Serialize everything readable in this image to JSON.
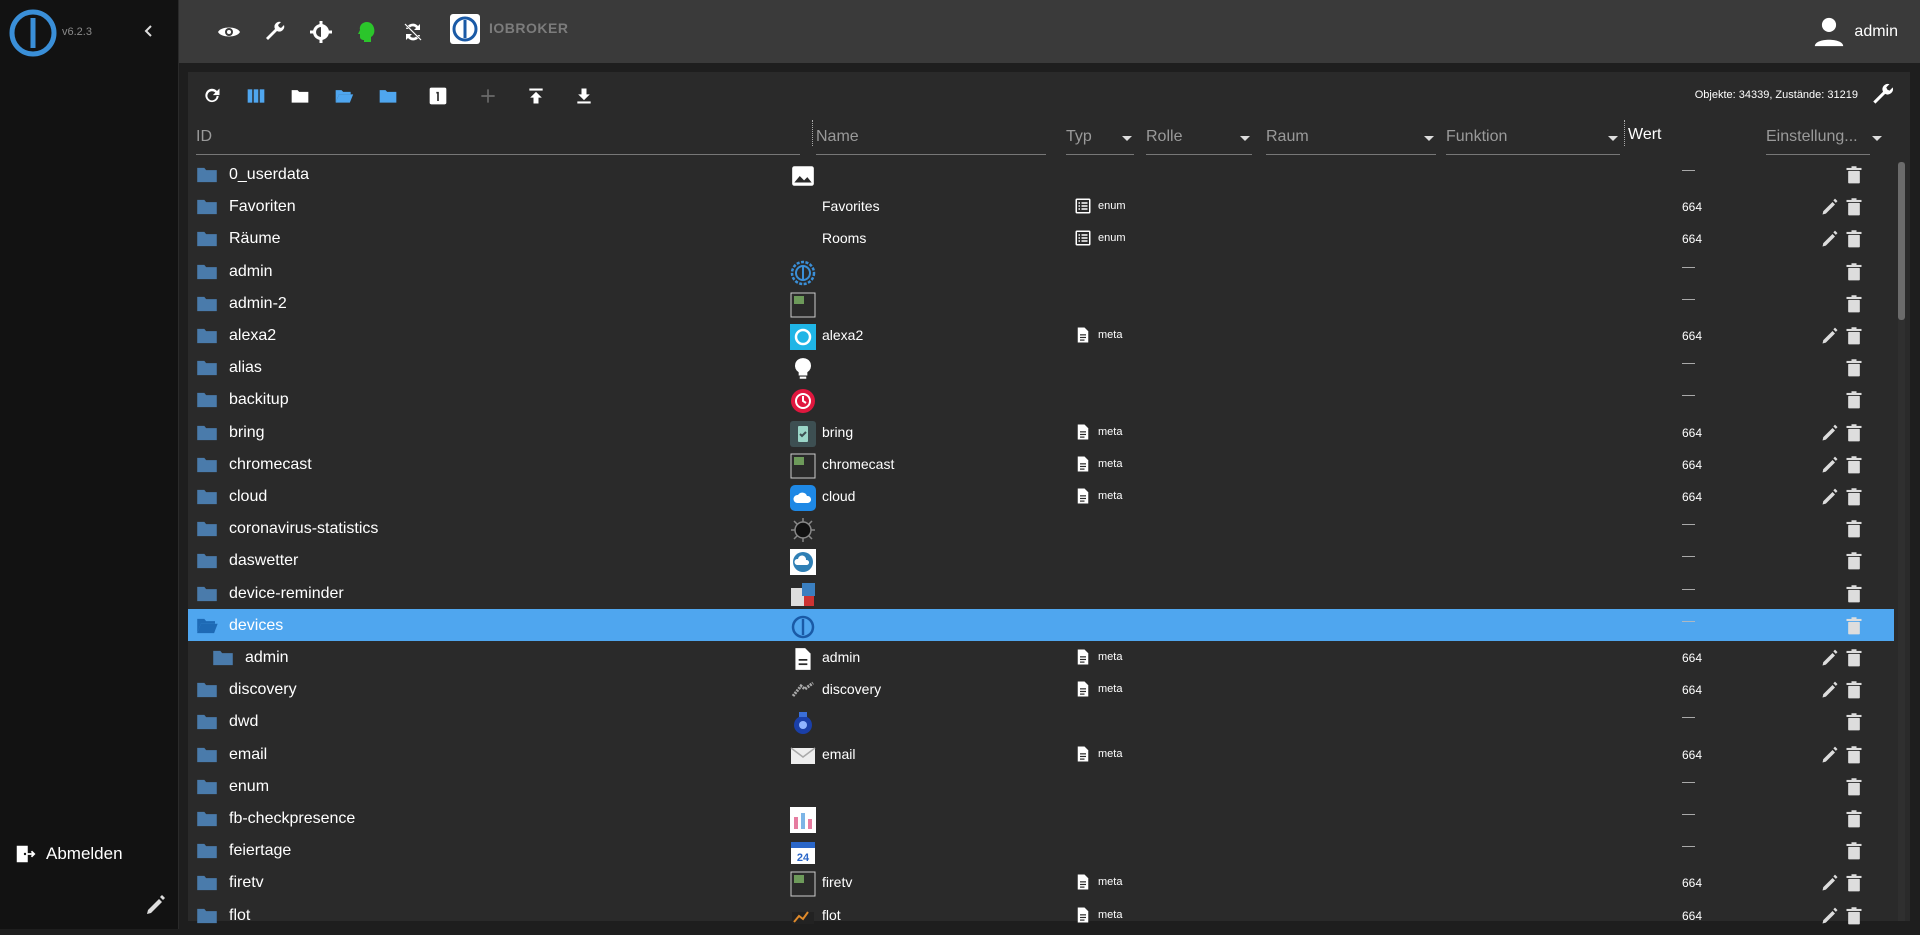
{
  "app": {
    "version": "v6.2.3",
    "brand_label": "IOBROKER",
    "user_name": "admin",
    "logout_label": "Abmelden"
  },
  "topbar_icons": [
    "eye-icon",
    "wrench-icon",
    "gear-icon",
    "head-icon",
    "sync-icon"
  ],
  "toolbar": {
    "stats": "Objekte: 34339, Zustände: 31219"
  },
  "columns": {
    "id": "ID",
    "name": "Name",
    "type": "Typ",
    "role": "Rolle",
    "room": "Raum",
    "function": "Funktion",
    "value": "Wert",
    "settings": "Einstellung..."
  },
  "rows": [
    {
      "id": "0_userdata",
      "icon": "image-icon",
      "name": "",
      "type": "",
      "rights": "—"
    },
    {
      "id": "Favoriten",
      "icon": "",
      "name": "Favorites",
      "type": "enum",
      "rights": "664"
    },
    {
      "id": "Räume",
      "icon": "",
      "name": "Rooms",
      "type": "enum",
      "rights": "664"
    },
    {
      "id": "admin",
      "icon": "iobroker-gear-icon",
      "name": "",
      "type": "",
      "rights": "—"
    },
    {
      "id": "admin-2",
      "icon": "broken-image-icon",
      "name": "",
      "type": "",
      "rights": "—"
    },
    {
      "id": "alexa2",
      "icon": "alexa-icon",
      "name": "alexa2",
      "type": "meta",
      "rights": "664"
    },
    {
      "id": "alias",
      "icon": "lightbulb-icon",
      "name": "",
      "type": "",
      "rights": "—"
    },
    {
      "id": "backitup",
      "icon": "backup-icon",
      "name": "",
      "type": "",
      "rights": "—"
    },
    {
      "id": "bring",
      "icon": "bring-icon",
      "name": "bring",
      "type": "meta",
      "rights": "664"
    },
    {
      "id": "chromecast",
      "icon": "broken-image-icon",
      "name": "chromecast",
      "type": "meta",
      "rights": "664"
    },
    {
      "id": "cloud",
      "icon": "cloud-icon",
      "name": "cloud",
      "type": "meta",
      "rights": "664"
    },
    {
      "id": "coronavirus-statistics",
      "icon": "virus-icon",
      "name": "",
      "type": "",
      "rights": "—"
    },
    {
      "id": "daswetter",
      "icon": "weather-icon",
      "name": "",
      "type": "",
      "rights": "—"
    },
    {
      "id": "device-reminder",
      "icon": "reminder-icon",
      "name": "",
      "type": "",
      "rights": "—"
    },
    {
      "id": "devices",
      "icon": "iobroker-logo-icon",
      "name": "",
      "type": "",
      "rights": "—",
      "selected": true,
      "open": true
    },
    {
      "id": "admin",
      "icon": "document-icon",
      "name": "admin",
      "type": "meta",
      "rights": "664",
      "child": true
    },
    {
      "id": "discovery",
      "icon": "discovery-icon",
      "name": "discovery",
      "type": "meta",
      "rights": "664"
    },
    {
      "id": "dwd",
      "icon": "dwd-icon",
      "name": "",
      "type": "",
      "rights": "—"
    },
    {
      "id": "email",
      "icon": "email-icon",
      "name": "email",
      "type": "meta",
      "rights": "664"
    },
    {
      "id": "enum",
      "icon": "",
      "name": "",
      "type": "",
      "rights": "—"
    },
    {
      "id": "fb-checkpresence",
      "icon": "chart-icon",
      "name": "",
      "type": "",
      "rights": "—"
    },
    {
      "id": "feiertage",
      "icon": "calendar-icon",
      "name": "",
      "type": "",
      "rights": "—"
    },
    {
      "id": "firetv",
      "icon": "broken-image-icon",
      "name": "firetv",
      "type": "meta",
      "rights": "664"
    },
    {
      "id": "flot",
      "icon": "flot-icon",
      "name": "flot",
      "type": "meta",
      "rights": "664"
    }
  ]
}
